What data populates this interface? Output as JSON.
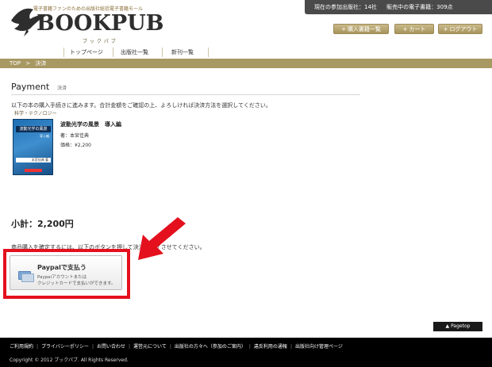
{
  "header": {
    "tagline": "電子書籍ファンのための出版社総括電子書籍モール",
    "logo_text": "BOOKPUB",
    "logo_kana": "ブックパブ",
    "stats": {
      "publishers_label": "現在の参加出版社：14社",
      "books_label": "販売中の電子書籍：309点"
    },
    "buttons": {
      "purchased": "購入書籍一覧",
      "cart": "カート",
      "logout": "ログアウト"
    }
  },
  "nav": {
    "items": [
      "トップページ",
      "出版社一覧",
      "新刊一覧"
    ]
  },
  "breadcrumb": {
    "top": "TOP",
    "sep": ">",
    "current": "決済"
  },
  "page": {
    "title": "Payment",
    "title_sub": "決済",
    "intro": "以下の本の購入手続きに進みます。合計金額をご確認の上、よろしければ決済方法を選択してください。"
  },
  "book": {
    "category": "科学・テクノロジー",
    "title": "波動光学の風景　導入編",
    "author": "著：本宮佳典",
    "price": "価格：¥2,200",
    "cover_title": "波動光学の風景",
    "cover_sub": "導入編",
    "cover_author": "本宮佳典 著"
  },
  "subtotal": "小計：2,200円",
  "instruction": "商品購入を確定するには、以下のボタンを押して決済を完了させてください。",
  "paypal": {
    "title": "Paypalで支払う",
    "desc1": "Paypalアカウントまたは",
    "desc2": "クレジットカードで支払いができます。"
  },
  "pagetop": "Pagetop",
  "footer": {
    "links": [
      "ご利用規約",
      "プライバシーポリシー",
      "お問い合わせ",
      "運営元について",
      "出版社の方々へ（参加のご案内）",
      "違反利用の通報",
      "出版社向け管理ページ"
    ],
    "copyright": "Copyright © 2012 ブックパブ. All Rights Reserved."
  },
  "colors": {
    "accent": "#a89862",
    "highlight": "#e4101e",
    "footer_bg": "#000000"
  }
}
